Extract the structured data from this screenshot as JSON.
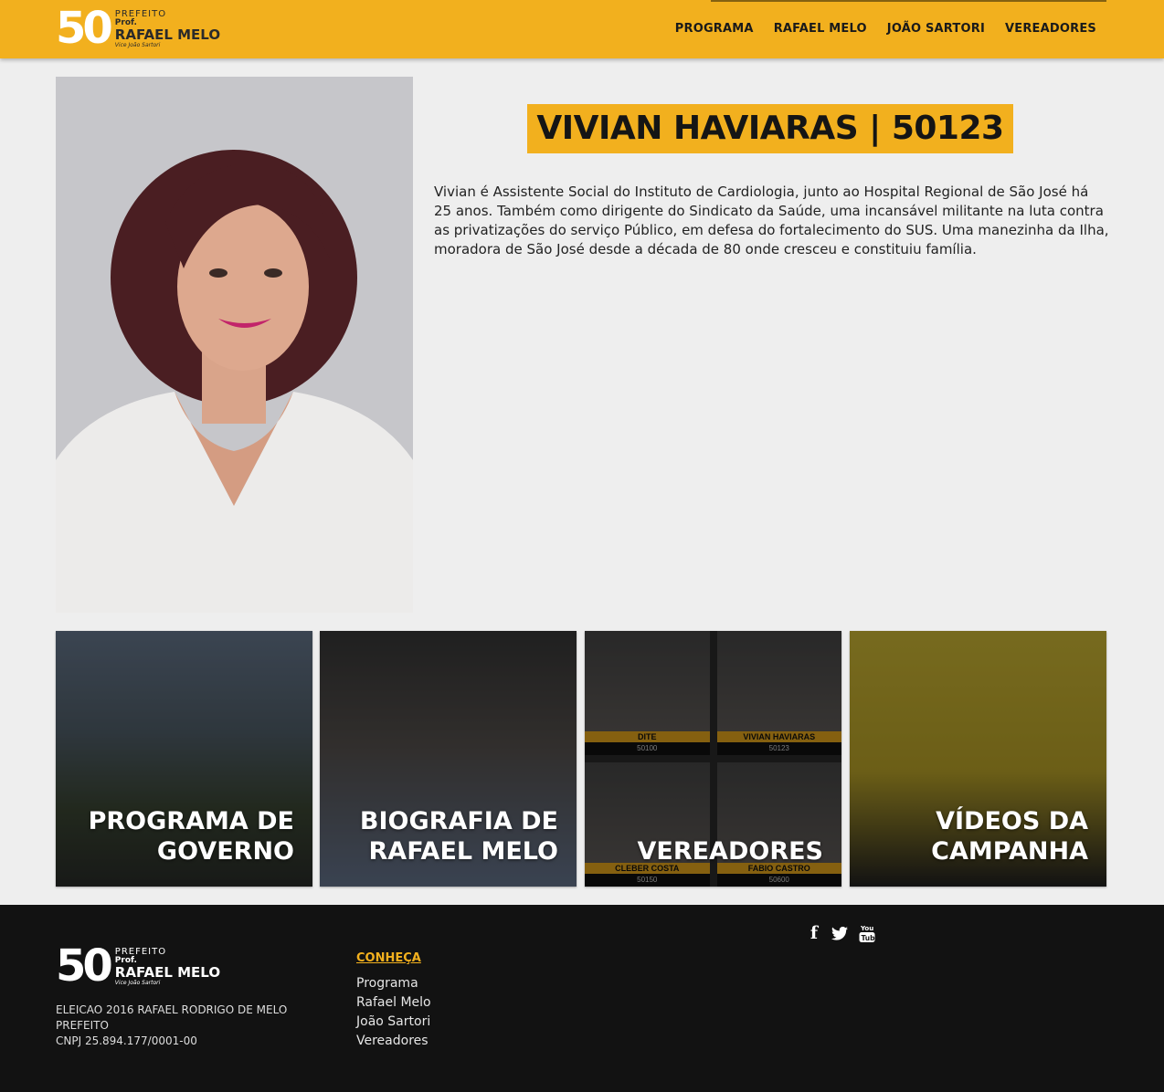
{
  "header": {
    "logo": {
      "number": "50",
      "line1": "PREFEITO",
      "line2": "Prof.",
      "line3": "RAFAEL MELO",
      "line4": "Vice João Sartori"
    },
    "nav": [
      "PROGRAMA",
      "RAFAEL MELO",
      "JOÃO SARTORI",
      "VEREADORES"
    ]
  },
  "profile": {
    "title": "VIVIAN HAVIARAS | 50123",
    "bio": "Vivian é Assistente Social do Instituto de Cardiologia, junto ao Hospital Regional de São José há 25 anos. Também como dirigente do Sindicato da Saúde, uma incansável militante na luta contra as privatizações do serviço Público, em defesa do fortalecimento do SUS. Uma manezinha da Ilha, moradora de São José desde a década de 80 onde cresceu e constituiu família."
  },
  "tiles": [
    {
      "label1": "PROGRAMA DE",
      "label2": "GOVERNO"
    },
    {
      "label1": "BIOGRAFIA DE",
      "label2": "RAFAEL MELO"
    },
    {
      "label1": "",
      "label2": "VEREADORES",
      "thumbs": [
        {
          "name": "DITE",
          "number": "50100"
        },
        {
          "name": "VIVIAN HAVIARAS",
          "number": "50123"
        },
        {
          "name": "CLEBER COSTA",
          "number": "50150"
        },
        {
          "name": "FABIO CASTRO",
          "number": "50600"
        }
      ]
    },
    {
      "label1": "VÍDEOS DA",
      "label2": "CAMPANHA"
    }
  ],
  "footer": {
    "logo": {
      "number": "50",
      "line1": "PREFEITO",
      "line2": "Prof.",
      "line3": "RAFAEL MELO",
      "line4": "Vice João Sartori"
    },
    "legal": [
      "ELEICAO 2016 RAFAEL RODRIGO DE MELO",
      "PREFEITO",
      "CNPJ 25.894.177/0001-00"
    ],
    "conheca_title": "CONHEÇA",
    "links": [
      "Programa",
      "Rafael Melo",
      "João Sartori",
      "Vereadores"
    ],
    "social": [
      "facebook-icon",
      "twitter-icon",
      "youtube-icon"
    ]
  },
  "colors": {
    "brand_yellow": "#f2b01e",
    "footer_bg": "#121212",
    "page_bg": "#eeeeee"
  }
}
